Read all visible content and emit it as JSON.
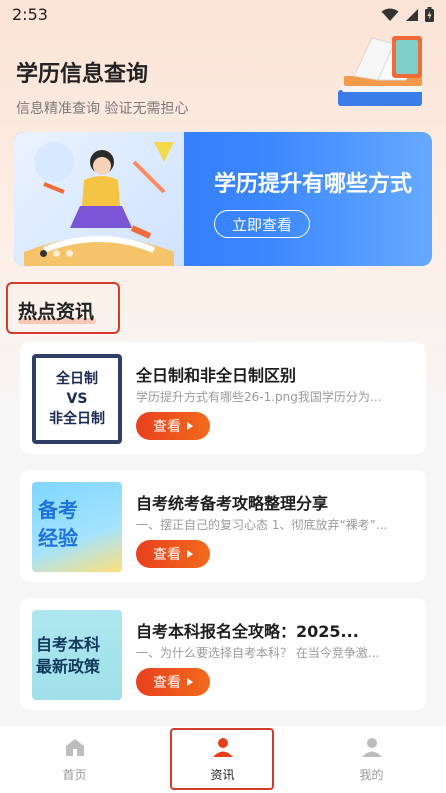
{
  "status_bar": {
    "time": "2:53"
  },
  "header": {
    "title": "学历信息查询",
    "subtitle": "信息精准查询 验证无需担心"
  },
  "banner": {
    "title": "学历提升有哪些方式",
    "button_label": "立即查看",
    "bg_color": "#3b87ff"
  },
  "section": {
    "title": "热点资讯"
  },
  "news": [
    {
      "thumb_lines": [
        "全日制",
        "VS",
        "非全日制"
      ],
      "title": "全日制和非全日制区别",
      "desc": "学历提升方式有哪些26-1.png我国学历分为两...",
      "button_label": "查看"
    },
    {
      "thumb_lines": [
        "备考",
        "经验"
      ],
      "title": "自考统考备考攻略整理分享",
      "desc": "一、摆正自己的复习心态 1、彻底放弃“裸考”...",
      "button_label": "查看"
    },
    {
      "thumb_lines": [
        "自考本科",
        "最新政策"
      ],
      "title": "自考本科报名全攻略：2025...",
      "desc": "一、为什么要选择自考本科？ 在当今竞争激...",
      "button_label": "查看"
    }
  ],
  "tabbar": {
    "items": [
      {
        "label": "首页",
        "icon": "home-icon"
      },
      {
        "label": "资讯",
        "icon": "news-user-icon"
      },
      {
        "label": "我的",
        "icon": "profile-icon"
      }
    ],
    "active_index": 1,
    "accent_color": "#e8401e"
  }
}
